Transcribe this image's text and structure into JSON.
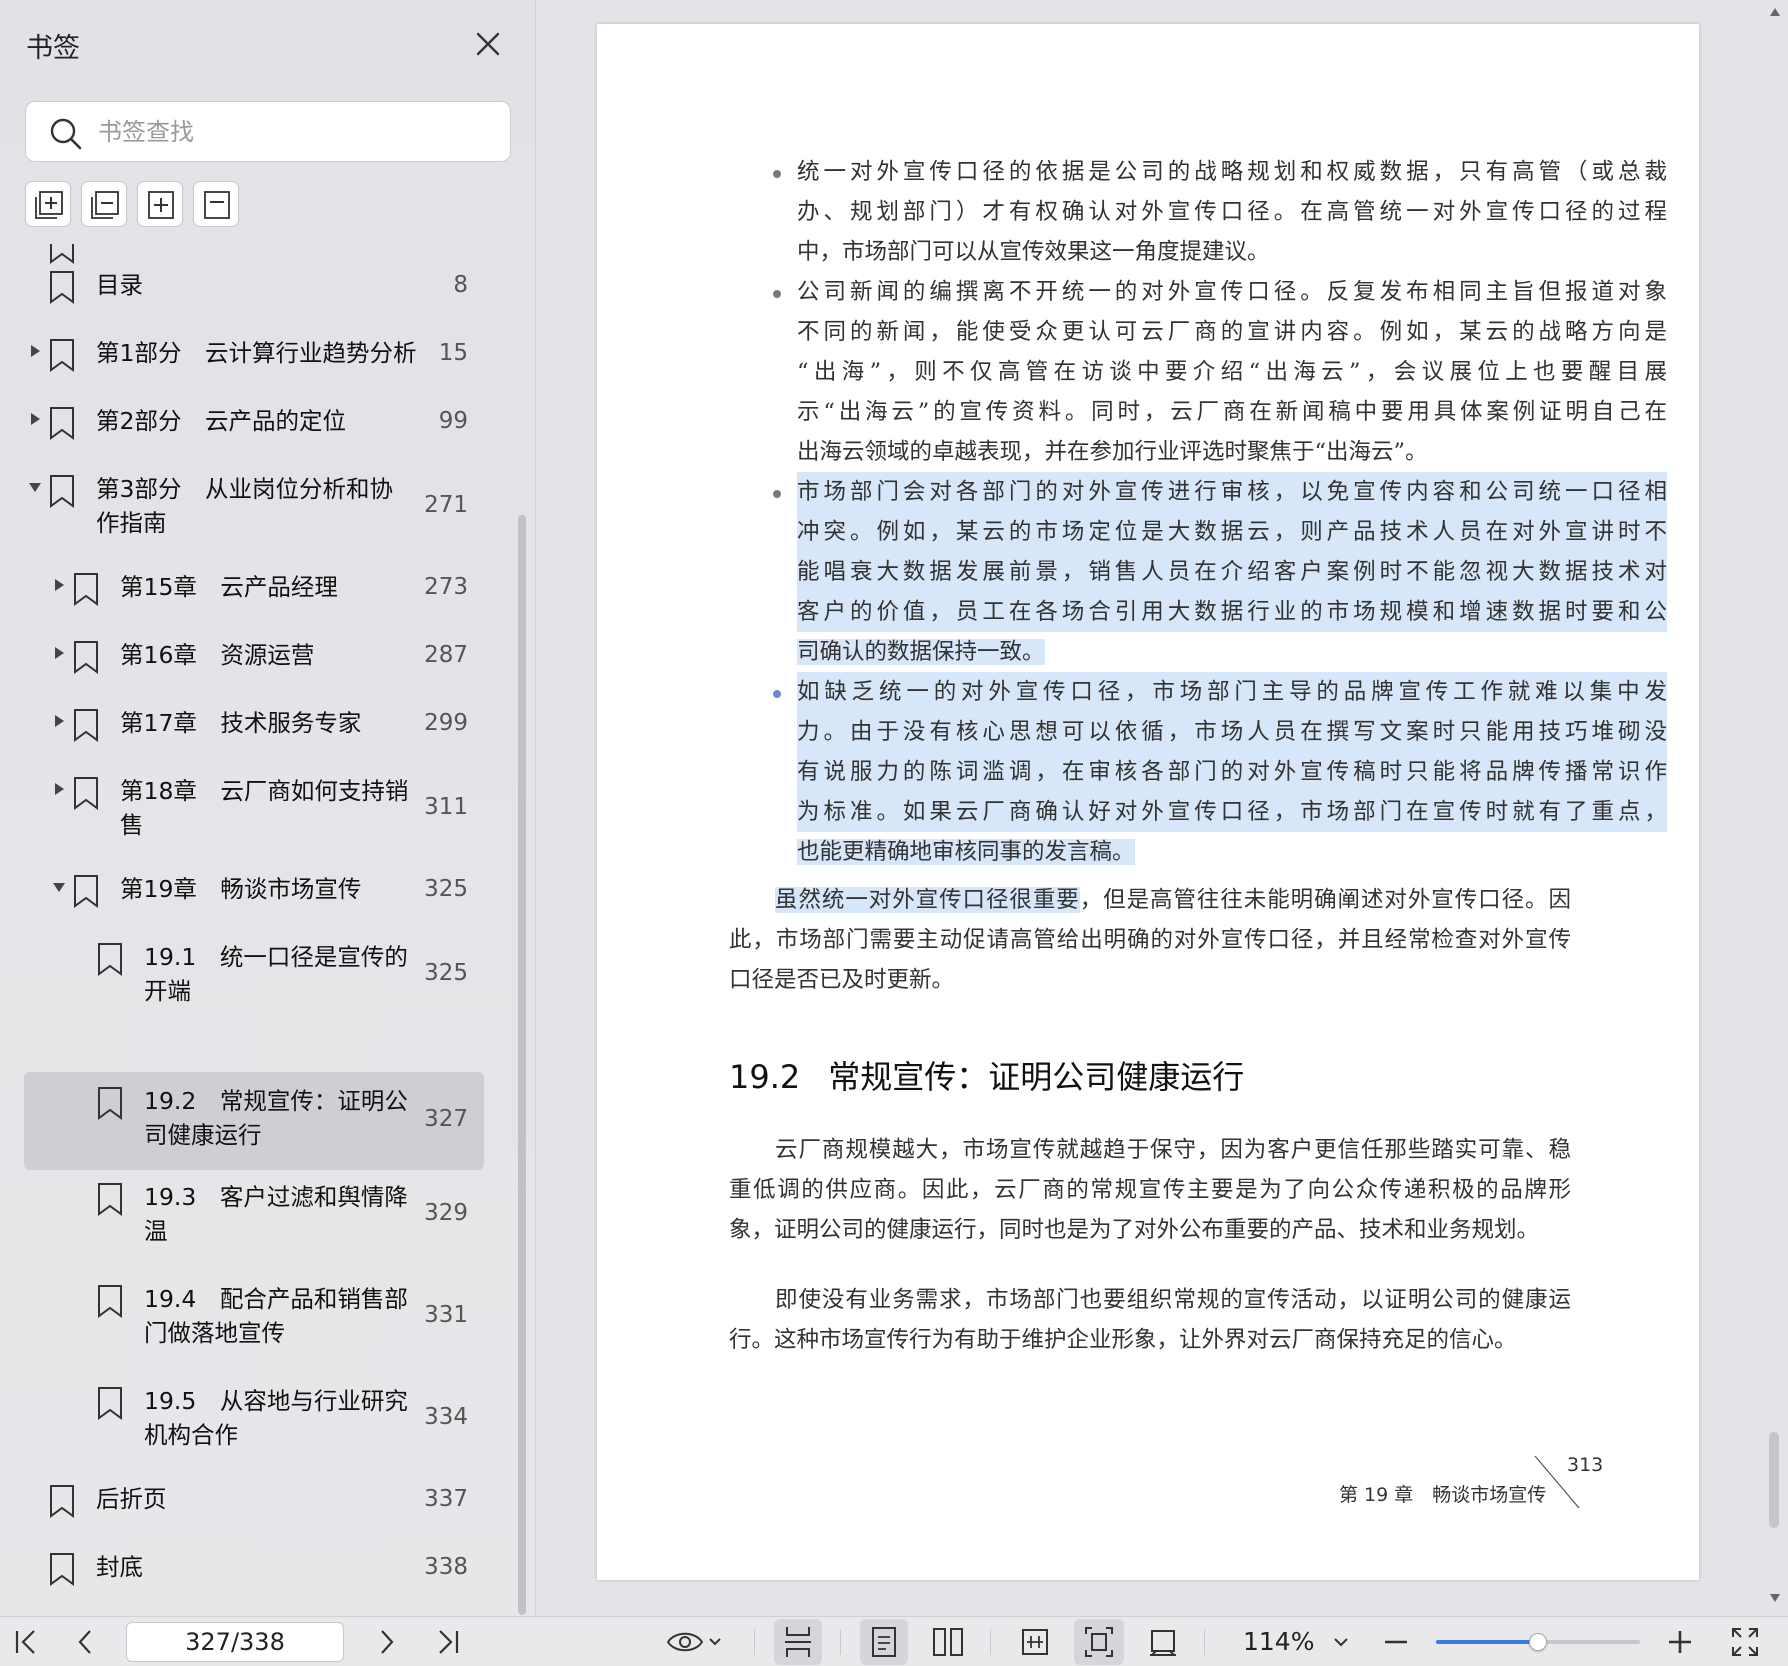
{
  "sidebar": {
    "title": "书签",
    "search_placeholder": "书签查找",
    "tools": [
      {
        "icon": "expand-all-icon"
      },
      {
        "icon": "collapse-all-icon"
      },
      {
        "icon": "add-bookmark-icon"
      },
      {
        "icon": "bookmark-current-icon"
      }
    ],
    "items": [
      {
        "label": "目录",
        "page": "8"
      },
      {
        "label": "第1部分　云计算行业趋势分析",
        "page": "15"
      },
      {
        "label": "第2部分　云产品的定位",
        "page": "99"
      },
      {
        "label": "第3部分　从业岗位分析和协作指南",
        "page": "271"
      },
      {
        "label": "第15章　云产品经理",
        "page": "273"
      },
      {
        "label": "第16章　资源运营",
        "page": "287"
      },
      {
        "label": "第17章　技术服务专家",
        "page": "299"
      },
      {
        "label": "第18章　云厂商如何支持销售",
        "page": "311"
      },
      {
        "label": "第19章　畅谈市场宣传",
        "page": "325"
      },
      {
        "label": "19.1　统一口径是宣传的开端",
        "page": "325"
      },
      {
        "label": "19.2　常规宣传：证明公司健康运行",
        "page": "327"
      },
      {
        "label": "19.3　客户过滤和舆情降温",
        "page": "329"
      },
      {
        "label": "19.4　配合产品和销售部门做落地宣传",
        "page": "331"
      },
      {
        "label": "19.5　从容地与行业研究机构合作",
        "page": "334"
      },
      {
        "label": "后折页",
        "page": "337"
      },
      {
        "label": "封底",
        "page": "338"
      }
    ],
    "labels_split": {
      "i3": [
        "第3部分　从业岗位分析和协",
        "作指南"
      ],
      "i7": [
        "第18章　云厂商如何支持销",
        "售"
      ],
      "i9": [
        "19.1　统一口径是宣传的",
        "开端"
      ],
      "i10": [
        "19.2　常规宣传：证明公",
        "司健康运行"
      ],
      "i11": [
        "19.3　客户过滤和舆情降",
        "温"
      ],
      "i12": [
        "19.4　配合产品和销售部",
        "门做落地宣传"
      ],
      "i13": [
        "19.5　从容地与行业研究",
        "机构合作"
      ]
    }
  },
  "document": {
    "bullets": [
      {
        "lines": [
          "统一对外宣传口径的依据是公司的战略规划和权威数据，只有高管（或总裁",
          "办、规划部门）才有权确认对外宣传口径。在高管统一对外宣传口径的过程",
          "中，市场部门可以从宣传效果这一角度提建议。"
        ]
      },
      {
        "lines": [
          "公司新闻的编撰离不开统一的对外宣传口径。反复发布相同主旨但报道对象",
          "不同的新闻，能使受众更认可云厂商的宣讲内容。例如，某云的战略方向是",
          "“出海”，则不仅高管在访谈中要介绍“出海云”，会议展位上也要醒目展",
          "示“出海云”的宣传资料。同时，云厂商在新闻稿中要用具体案例证明自己在",
          "出海云领域的卓越表现，并在参加行业评选时聚焦于“出海云”。"
        ]
      },
      {
        "lines": [
          "市场部门会对各部门的对外宣传进行审核，以免宣传内容和公司统一口径相",
          "冲突。例如，某云的市场定位是大数据云，则产品技术人员在对外宣讲时不",
          "能唱衰大数据发展前景，销售人员在介绍客户案例时不能忽视大数据技术对",
          "客户的价值，员工在各场合引用大数据行业的市场规模和增速数据时要和公",
          "司确认的数据保持一致。"
        ]
      },
      {
        "lines": [
          "如缺乏统一的对外宣传口径，市场部门主导的品牌宣传工作就难以集中发",
          "力。由于没有核心思想可以依循，市场人员在撰写文案时只能用技巧堆砌没",
          "有说服力的陈词滥调，在审核各部门的对外宣传稿时只能将品牌传播常识作",
          "为标准。如果云厂商确认好对外宣传口径，市场部门在宣传时就有了重点，",
          "也能更精确地审核同事的发言稿。"
        ]
      }
    ],
    "para1": {
      "first_hl": "虽然统一对外宣传口径很重要",
      "first_rest": "，但是高管往往未能明确阐述对外宣传口径。因",
      "lines": [
        "此，市场部门需要主动促请高管给出明确的对外宣传口径，并且经常检查对外宣传",
        "口径是否已及时更新。"
      ]
    },
    "section": {
      "number": "19.2",
      "title": "常规宣传：证明公司健康运行"
    },
    "para2": {
      "lines": [
        "云厂商规模越大，市场宣传就越趋于保守，因为客户更信任那些踏实可靠、稳",
        "重低调的供应商。因此，云厂商的常规宣传主要是为了向公众传递积极的品牌形",
        "象，证明公司的健康运行，同时也是为了对外公布重要的产品、技术和业务规划。"
      ]
    },
    "para3": {
      "lines": [
        "即使没有业务需求，市场部门也要组织常规的宣传活动，以证明公司的健康运",
        "行。这种市场宣传行为有助于维护企业形象，让外界对云厂商保持充足的信心。"
      ]
    },
    "footer": {
      "chapter": "第 19 章　畅谈市场宣传",
      "page_number": "313"
    }
  },
  "toolbar": {
    "page_indicator": "327/338",
    "zoom": "114%",
    "zoom_fraction": 0.5
  }
}
